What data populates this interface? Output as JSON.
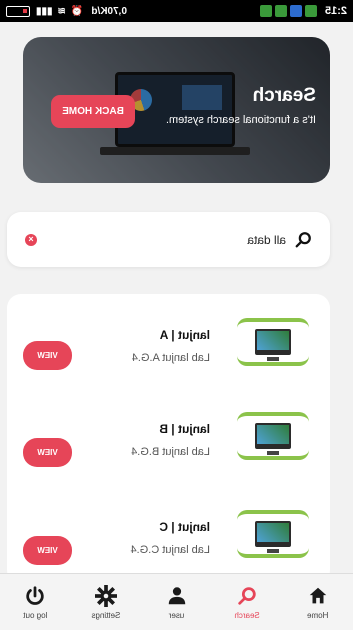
{
  "status_bar": {
    "time": "2:15",
    "speed": "0,70K/d",
    "icon_names": [
      "signal-icon",
      "wifi-icon",
      "alarm-icon",
      "battery-icon"
    ]
  },
  "hero": {
    "title": "Search",
    "subtitle": "It's a functional search system.",
    "back_button": "BACK HOME"
  },
  "search": {
    "value": "all data",
    "icon": "search-icon",
    "clear_icon": "close-circle-icon"
  },
  "items": [
    {
      "title": "lanjut | A",
      "subtitle": "Lab lanjut A.G.4",
      "action": "VIEW"
    },
    {
      "title": "lanjut | B",
      "subtitle": "Lab lanjut B.G.4",
      "action": "VIEW"
    },
    {
      "title": "lanjut | C",
      "subtitle": "Lab lanjut C.G.4",
      "action": "VIEW"
    }
  ],
  "nav": {
    "items": [
      {
        "label": "Home",
        "icon": "home-icon",
        "active": false
      },
      {
        "label": "Search",
        "icon": "search-icon",
        "active": true
      },
      {
        "label": "user",
        "icon": "user-icon",
        "active": false
      },
      {
        "label": "Settings",
        "icon": "gear-icon",
        "active": false
      },
      {
        "label": "log out",
        "icon": "power-icon",
        "active": false
      }
    ]
  },
  "colors": {
    "accent": "#e64558",
    "thumb_border": "#8bc34a",
    "background": "#f2f2f2"
  }
}
